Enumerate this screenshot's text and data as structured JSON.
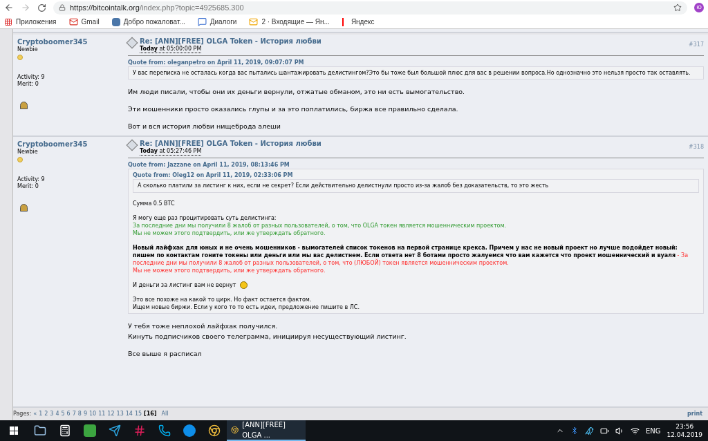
{
  "browser": {
    "url_host": "https://bitcointalk.org",
    "url_path": "/index.php?topic=4925685.300",
    "profile_initial": "Ю"
  },
  "bookmarks": [
    {
      "kind": "apps",
      "label": "Приложения"
    },
    {
      "kind": "gmail",
      "label": "Gmail"
    },
    {
      "kind": "vk",
      "label": "Добро пожаловат..."
    },
    {
      "kind": "dialogs",
      "label": "Диалоги"
    },
    {
      "kind": "mail",
      "label": "2 · Входящие — Ян..."
    },
    {
      "kind": "yandex",
      "label": "Яндекс"
    }
  ],
  "posts": [
    {
      "author": "Cryptoboomer345",
      "rank": "Newbie",
      "activity": "Activity: 9",
      "merit": "Merit: 0",
      "title": "Re: [ANN][FREE] OLGA Token - История любви",
      "date_bold": "Today",
      "date_rest": " at 05:00:00 PM",
      "number": "#317",
      "quote": {
        "header": "Quote from: oleganpetro on April 11, 2019, 09:07:07 PM",
        "paragraphs": [
          [
            [
              {
                "kind": "text",
                "text": "У вас переписка не осталась когда вас пытались шантажировать делистингом?Это бы тоже был большой плюс для вас в решении вопроса.Но однозначно это нельзя просто так оставлять."
              }
            ]
          ]
        ]
      },
      "body": [
        "Им люди писали, чтобы они их деньги вернули, отжатые обманом, это ни есть вымогательство.",
        "Эти мошенники просто оказались глупы и за это поплатились, биржа все правильно сделала.",
        "Вот и вся история любви нищеброда алеши"
      ]
    },
    {
      "author": "Cryptoboomer345",
      "rank": "Newbie",
      "activity": "Activity: 9",
      "merit": "Merit: 0",
      "title": "Re: [ANN][FREE] OLGA Token - История любви",
      "date_bold": "Today",
      "date_rest": " at 05:27:46 PM",
      "number": "#318",
      "quote": {
        "header": "Quote from: Jazzane on April 11, 2019, 08:13:46 PM",
        "nested": {
          "header": "Quote from: Oleg12 on April 11, 2019, 02:33:06 PM",
          "text": "А сколько платили за листинг к них, если не секрет? Если действительно делистнули просто из-за жалоб без доказательств, то это жесть"
        },
        "paragraphs": [
          [
            [
              {
                "kind": "text",
                "text": "Сумма 0.5 BTC"
              }
            ]
          ],
          [
            [
              {
                "kind": "text",
                "text": "Я могу еще раз процитировать суть делистинга:"
              }
            ],
            [
              {
                "kind": "text",
                "text": "За последние дни мы получили 8 жалоб от разных пользователей, о том, что OLGA токен является мошенническим проектом.",
                "color": "#2f9a2f"
              }
            ],
            [
              {
                "kind": "text",
                "text": "Мы не можем этого подтвердить, или же утверждать обратного.",
                "color": "#2f9a2f"
              }
            ]
          ],
          [
            [
              {
                "kind": "text",
                "text": "**Новый лайфхак для юных и не очень мошенников - вымогателей список токенов на первой странице крекса. Причем у нас не новый проект но лучше подойдет новый: пишем по контактам гоните токены или деньги или мы вас делистнем. Если ответа нет 8 ботами просто жалуемся что вам кажется что проект мошеннический и вуаля**"
              },
              {
                "kind": "text",
                "text": " - За последние дни мы получили 8 жалоб от разных пользователей, о том, что (ЛЮБОЙ) токен является мошенническим проектом.",
                "color": "#ff2a2a"
              }
            ],
            [
              {
                "kind": "text",
                "text": "Мы не можем этого подтвердить, или же утверждать обратного.",
                "color": "#ff2a2a"
              }
            ]
          ],
          [
            [
              {
                "kind": "text",
                "text": "И деньги за листинг вам не вернут"
              },
              {
                "kind": "smiley"
              }
            ]
          ],
          [
            [
              {
                "kind": "text",
                "text": "Это все похоже на какой то цирк. Но факт остается фактом."
              }
            ],
            [
              {
                "kind": "text",
                "text": "Ищем новые биржи. Если у кого то то есть идеи, предложение пишите в ЛС."
              }
            ]
          ]
        ]
      },
      "body": [
        "У тебя тоже неплохой лайфхак получился.\nКинуть подписчиков своего телеграмма, инициируя несуществующий листинг.",
        "Все выше я расписал"
      ]
    }
  ],
  "pagination": {
    "label": "Pages:",
    "prev": "«",
    "pages": [
      {
        "label": "1",
        "selected": false
      },
      {
        "label": "2",
        "selected": false
      },
      {
        "label": "3",
        "selected": false
      },
      {
        "label": "4",
        "selected": false
      },
      {
        "label": "5",
        "selected": false
      },
      {
        "label": "6",
        "selected": false
      },
      {
        "label": "7",
        "selected": false
      },
      {
        "label": "8",
        "selected": false
      },
      {
        "label": "9",
        "selected": false
      },
      {
        "label": "10",
        "selected": false
      },
      {
        "label": "11",
        "selected": false
      },
      {
        "label": "12",
        "selected": false
      },
      {
        "label": "13",
        "selected": false
      },
      {
        "label": "14",
        "selected": false
      },
      {
        "label": "15",
        "selected": false
      },
      {
        "label": "[16]",
        "selected": true
      }
    ],
    "all": "All",
    "print": "print"
  },
  "taskbar": {
    "apps": [
      {
        "kind": "files"
      },
      {
        "kind": "calculator"
      },
      {
        "kind": "camtasia"
      },
      {
        "kind": "telegram"
      },
      {
        "kind": "slack"
      },
      {
        "kind": "skype"
      },
      {
        "kind": "teamviewer"
      },
      {
        "kind": "chrome"
      }
    ],
    "window": "[ANN][FREE] OLGA ...",
    "language": "ENG",
    "time": "23:56",
    "date": "12.04.2019"
  }
}
